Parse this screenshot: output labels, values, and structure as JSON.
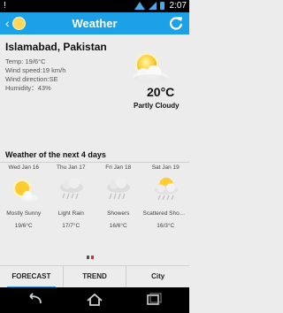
{
  "status_bar": {
    "time": "2:07",
    "alert_glyph": "!"
  },
  "title_bar": {
    "title": "Weather"
  },
  "current": {
    "city": "Islamabad, Pakistan",
    "details": [
      "Temp: 19/6°C",
      "Wind speed:19 km/h",
      "Wind direction:SE",
      "Humidity：43%"
    ],
    "temperature": "20°C",
    "condition": "Partly Cloudy",
    "icon": "partly-cloudy-icon"
  },
  "forecast": {
    "title": "Weather of the next 4 days",
    "days": [
      {
        "day": "Wed Jan 16",
        "desc": "Mostly Sunny",
        "temp": "19/6°C",
        "icon": "sunny-icon"
      },
      {
        "day": "Thu Jan 17",
        "desc": "Light Rain",
        "temp": "17/7°C",
        "icon": "rain-cloud-icon"
      },
      {
        "day": "Fri Jan 18",
        "desc": "Showers",
        "temp": "16/6°C",
        "icon": "rain-cloud-icon"
      },
      {
        "day": "Sat Jan 19",
        "desc": "Scattered Showers",
        "temp": "16/3°C",
        "icon": "sun-rain-cloud-icon"
      }
    ]
  },
  "tabs": [
    {
      "label": "FORECAST",
      "active": true
    },
    {
      "label": "TREND",
      "active": false
    },
    {
      "label": "City",
      "active": false
    }
  ],
  "colors": {
    "accent": "#1da1e6",
    "pager_active": "#e02a2a"
  }
}
